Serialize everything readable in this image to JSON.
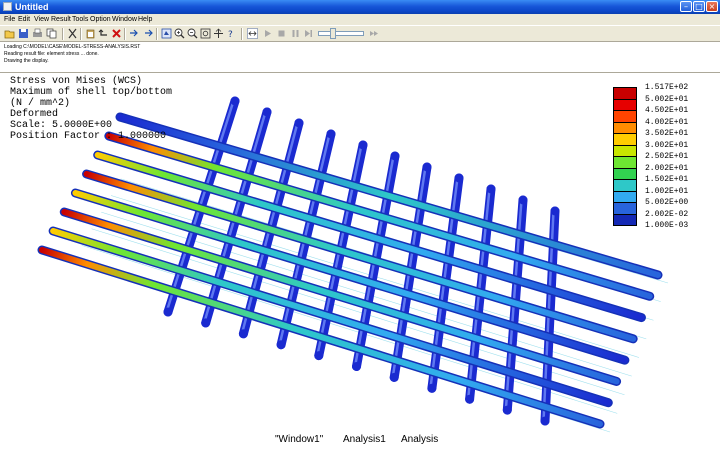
{
  "window": {
    "title": "Untitled"
  },
  "menu": {
    "items": [
      "File",
      "Edit",
      "View",
      "Result",
      "Tools",
      "Option",
      "Window",
      "Help"
    ]
  },
  "toolbar": {
    "icons": [
      "open-icon",
      "save-icon",
      "print-icon",
      "copy-icon",
      "cut-icon",
      "paste-icon",
      "undo-icon",
      "delete-icon",
      "import-icon",
      "export-icon",
      "rotate-icon",
      "zoom-in-icon",
      "zoom-out-icon",
      "zoom-fit-icon",
      "pan-icon",
      "query-icon",
      "animate-icon",
      "play-icon",
      "stop-icon",
      "pause-icon",
      "step-icon",
      "frame-slider",
      "end-icon"
    ]
  },
  "messages": [
    "Loading C:\\MODEL\\CASE\\MODEL-STRESS-ANALYSIS.RST",
    "Reading result file: element stress ... done.",
    "Drawing the display."
  ],
  "result_info": [
    "Stress von Mises (WCS)",
    "Maximum of shell top/bottom",
    "(N / mm^2)",
    "Deformed",
    "Scale: 5.0000E+00",
    "Position Factor : 1.000000"
  ],
  "legend": {
    "values": [
      "1.517E+02",
      "5.002E+01",
      "4.502E+01",
      "4.002E+01",
      "3.502E+01",
      "3.002E+01",
      "2.502E+01",
      "2.002E+01",
      "1.502E+01",
      "1.002E+01",
      "5.002E+00",
      "2.002E-02",
      "1.000E-03"
    ],
    "colors": [
      "#c80000",
      "#e60000",
      "#ff4400",
      "#ff8c00",
      "#ffcc00",
      "#c8e600",
      "#6ee632",
      "#32d250",
      "#2ec8c8",
      "#32aaf0",
      "#2864dc",
      "#1428b4"
    ]
  },
  "tabs": [
    "\"Window1\"",
    "Analysis1",
    "Analysis"
  ]
}
